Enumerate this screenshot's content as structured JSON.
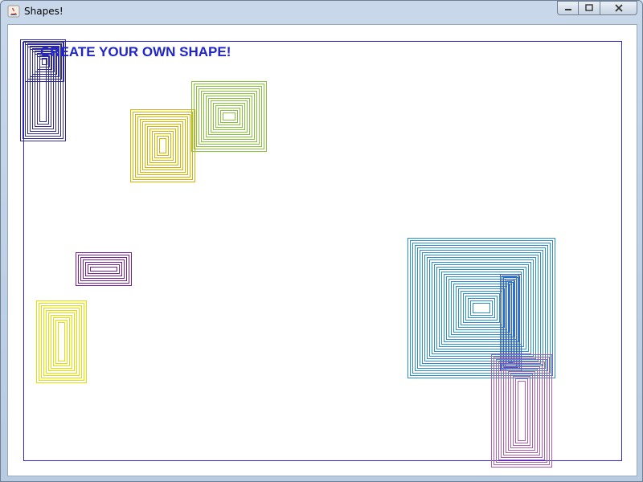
{
  "window": {
    "title": "Shapes!",
    "controls": [
      "minimize-icon",
      "maximize-icon",
      "close-icon"
    ]
  },
  "canvas": {
    "heading": "CREATE YOUR OWN SHAPE!",
    "heading_color": "#1f25c8",
    "border_color": "#2a2ad0"
  },
  "colors": {
    "navy": "#2f2a9a",
    "gold": "#d6b400",
    "green": "#86c23a",
    "purple": "#7a1f95",
    "yellow": "#e4e000",
    "cyan": "#2a8fcf",
    "blue": "#2f5fd0",
    "magenta": "#b05fb0"
  }
}
